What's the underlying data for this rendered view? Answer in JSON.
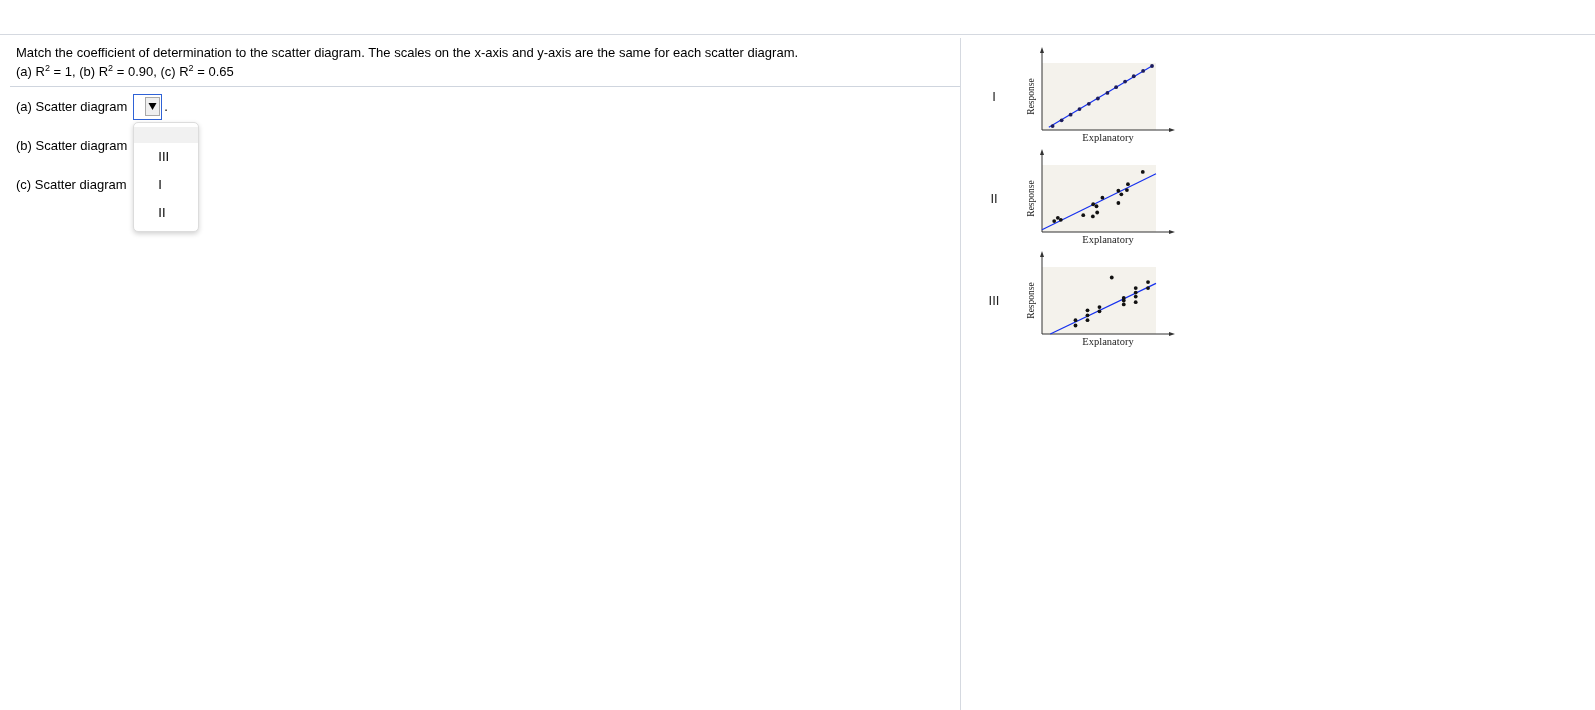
{
  "question": {
    "instruction": "Match the coefficient of determination to the scatter diagram. The scales on the x-axis and y-axis are the same for each scatter diagram.",
    "values": "(a) R$^{2}$ = 1, (b) R$^{2}$ = 0.90, (c) R$^{2}$ = 0.65"
  },
  "answers": [
    {
      "label": "(a) Scatter diagram",
      "dropdown": {
        "focused": true,
        "open": true,
        "blank_option": {
          "selected": true
        },
        "options": [
          {
            "label": "III",
            "selected": false
          },
          {
            "label": "I",
            "selected": false
          },
          {
            "label": "II",
            "selected": false
          }
        ]
      },
      "suffix": "."
    },
    {
      "label": "(b) Scatter diagram"
    },
    {
      "label": "(c) Scatter diagram"
    }
  ],
  "diagrams": [
    {
      "label": "I",
      "x_axis_label": "Explanatory",
      "y_axis_label": "Response"
    },
    {
      "label": "II",
      "x_axis_label": "Explanatory",
      "y_axis_label": "Response"
    },
    {
      "label": "III",
      "x_axis_label": "Explanatory",
      "y_axis_label": "Response"
    }
  ]
}
